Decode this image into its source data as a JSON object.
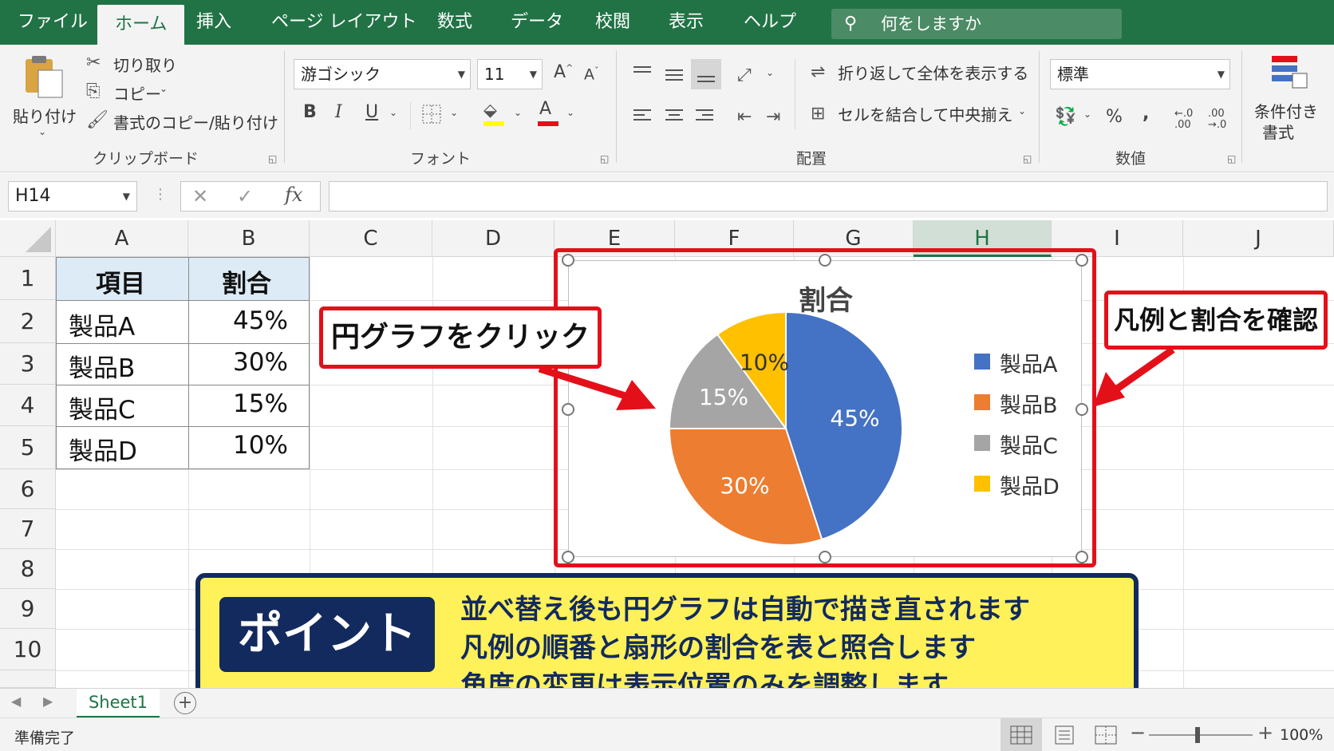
{
  "ribbon_tabs": [
    "ファイル",
    "ホーム",
    "挿入",
    "ページ レイアウト",
    "数式",
    "データ",
    "校閲",
    "表示",
    "ヘルプ"
  ],
  "active_tab": "ホーム",
  "tell_me": "何をしますか",
  "clipboard": {
    "paste": "貼り付け",
    "cut": "切り取り",
    "copy": "コピー",
    "format_painter": "書式のコピー/貼り付け",
    "label": "クリップボード"
  },
  "font": {
    "name": "游ゴシック",
    "size": "11",
    "grow": "A",
    "shrink": "A",
    "bold": "B",
    "italic": "I",
    "underline": "U",
    "color_glyph": "A",
    "label": "フォント"
  },
  "alignment": {
    "wrap": "折り返して全体を表示する",
    "merge": "セルを結合して中央揃え",
    "label": "配置"
  },
  "number": {
    "format": "標準",
    "percent": "%",
    "comma": ",",
    "inc_decimal": "←.0 .00",
    "dec_decimal": ".00 →.0",
    "label": "数値"
  },
  "styles": {
    "conditional_line1": "条件付き",
    "conditional_line2": "書式"
  },
  "formula_bar": {
    "name_box": "H14",
    "cancel": "✕",
    "enter": "✓",
    "fx": "fx",
    "content": ""
  },
  "columns": [
    "A",
    "B",
    "C",
    "D",
    "E",
    "F",
    "G",
    "H",
    "I",
    "J"
  ],
  "selected_column": "H",
  "rows": [
    "1",
    "2",
    "3",
    "4",
    "5",
    "6",
    "7",
    "8",
    "9",
    "10"
  ],
  "table": {
    "headers": [
      "項目",
      "割合"
    ],
    "rows": [
      [
        "製品A",
        "45%"
      ],
      [
        "製品B",
        "30%"
      ],
      [
        "製品C",
        "15%"
      ],
      [
        "製品D",
        "10%"
      ]
    ],
    "header_fill": "#ddebf7"
  },
  "chart_data": {
    "type": "pie",
    "title": "割合",
    "categories": [
      "製品A",
      "製品B",
      "製品C",
      "製品D"
    ],
    "values": [
      45,
      30,
      15,
      10
    ],
    "labels": [
      "45%",
      "30%",
      "15%",
      "10%"
    ],
    "colors": [
      "#4472c4",
      "#ed7d31",
      "#a5a5a5",
      "#ffc000"
    ],
    "legend_position": "right"
  },
  "callouts": {
    "click_pie": "円グラフをクリック",
    "check_legend": "凡例と割合を確認"
  },
  "point": {
    "badge": "ポイント",
    "lines": [
      "並べ替え後も円グラフは自動で描き直されます",
      "凡例の順番と扇形の割合を表と照合します",
      "角度の変更は表示位置のみを調整します"
    ]
  },
  "sheet_tab": "Sheet1",
  "status": {
    "ready": "準備完了",
    "zoom": "100%"
  },
  "colors": {
    "excel_green": "#217346",
    "red": "#e3101a",
    "navy": "#132a5e",
    "yellow": "#fff15a"
  }
}
